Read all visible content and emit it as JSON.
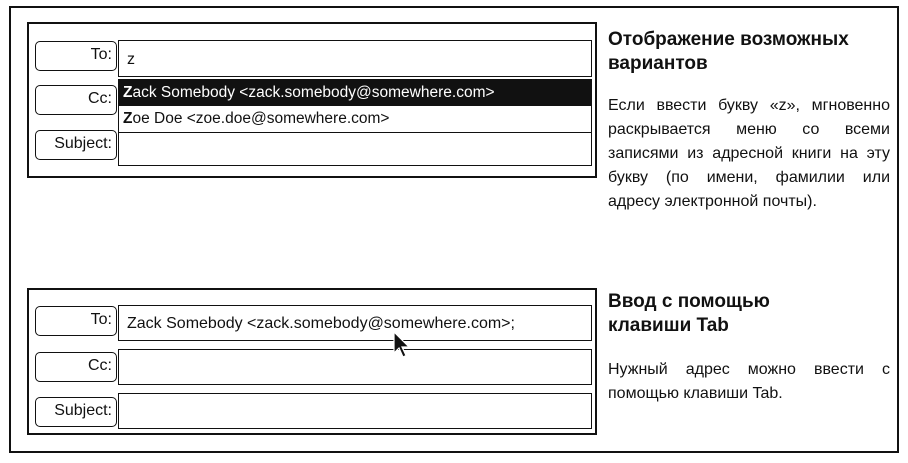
{
  "top_example": {
    "to_label": "To:",
    "cc_label": "Cc:",
    "subject_label": "Subject:",
    "to_value": "z",
    "suggestions": [
      {
        "match": "Z",
        "rest": "ack Somebody <zack.somebody@somewhere.com>",
        "selected": true
      },
      {
        "match": "Z",
        "rest": "oe Doe <zoe.doe@somewhere.com>",
        "selected": false
      }
    ],
    "heading": "Отображение возможных вариантов",
    "description": "Если ввести букву «z», мгновенно раскрывается меню со всеми записями из адресной книги на эту букву (по имени, фамилии или адресу электронной почты)."
  },
  "bottom_example": {
    "to_label": "To:",
    "cc_label": "Cc:",
    "subject_label": "Subject:",
    "to_value": "Zack Somebody <zack.somebody@somewhere.com>;",
    "heading": "Ввод с помощью клавиши Tab",
    "description": "Нужный адрес можно ввести с помощью клавиши Tab.",
    "cursor_icon": "mouse-pointer-icon"
  }
}
